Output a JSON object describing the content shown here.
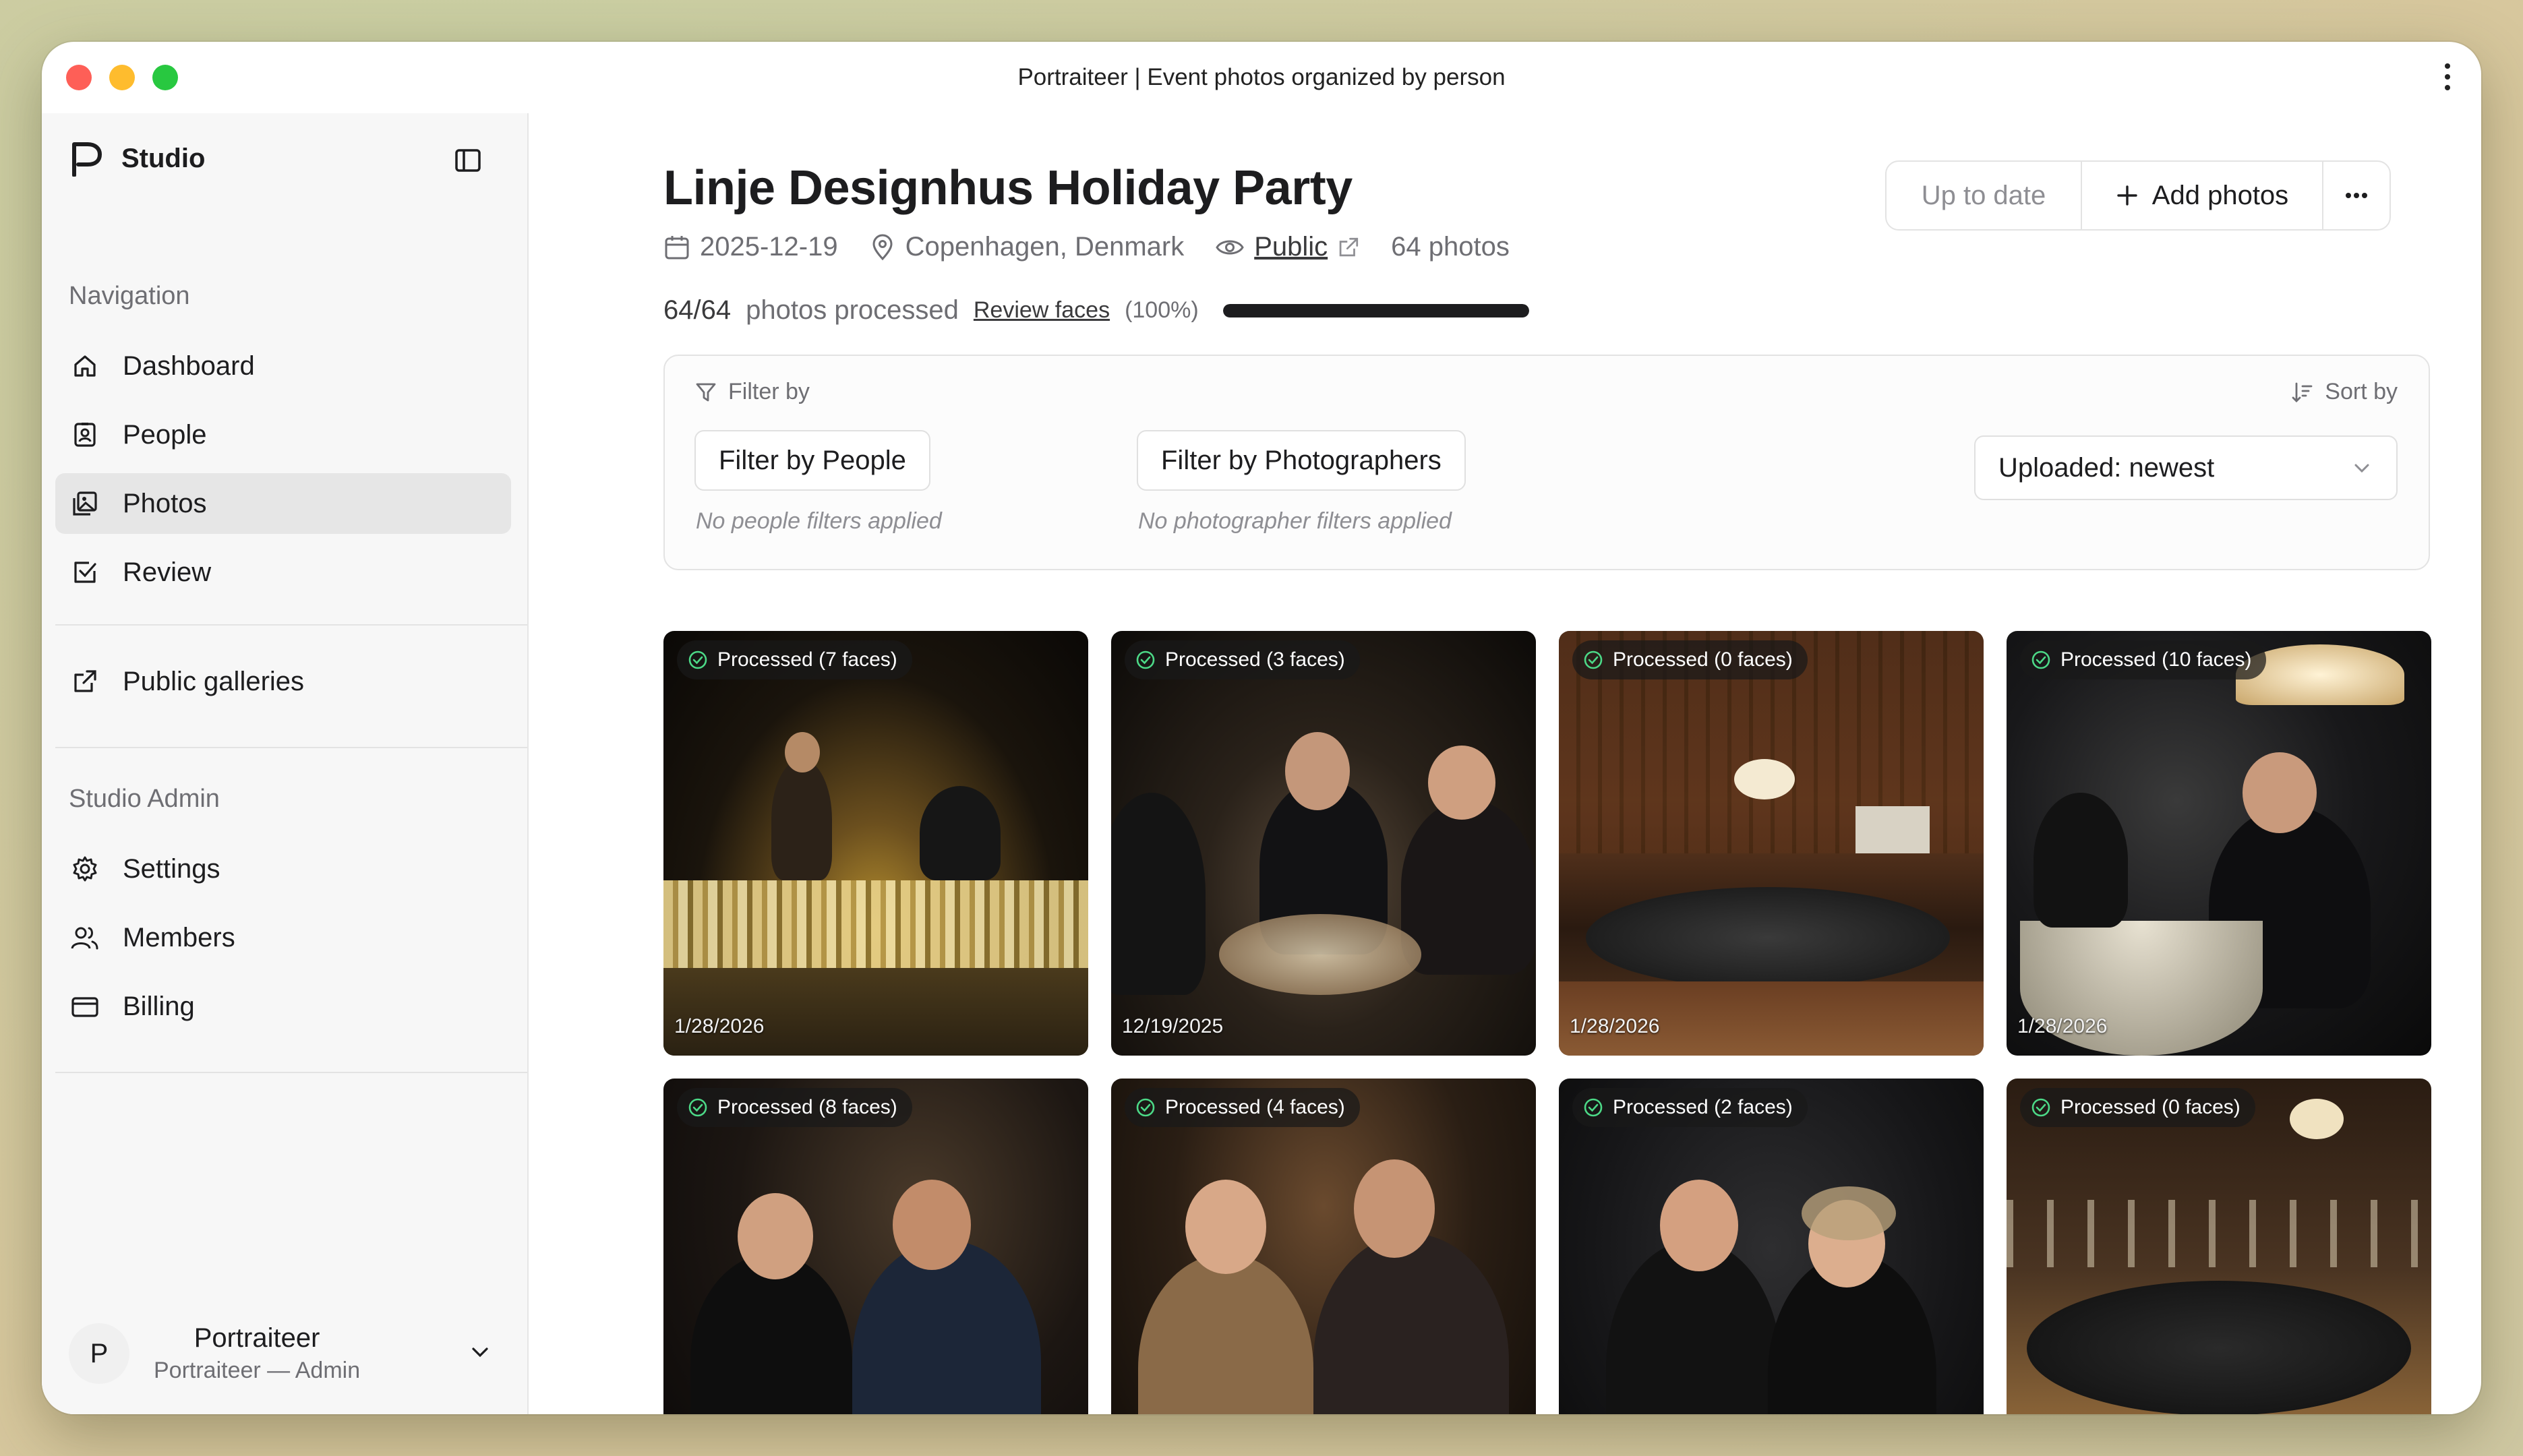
{
  "window": {
    "title": "Portraiteer | Event photos organized by person"
  },
  "sidebar": {
    "brand": "Studio",
    "nav_label": "Navigation",
    "nav": [
      {
        "label": "Dashboard",
        "icon": "home-icon"
      },
      {
        "label": "People",
        "icon": "person-badge-icon"
      },
      {
        "label": "Photos",
        "icon": "photos-icon",
        "active": true
      },
      {
        "label": "Review",
        "icon": "checkbox-icon"
      }
    ],
    "public_galleries": "Public galleries",
    "admin_label": "Studio Admin",
    "admin": [
      {
        "label": "Settings",
        "icon": "gear-icon"
      },
      {
        "label": "Members",
        "icon": "users-icon"
      },
      {
        "label": "Billing",
        "icon": "card-icon"
      }
    ],
    "user": {
      "initial": "P",
      "name": "Portraiteer",
      "role": "Portraiteer — Admin"
    }
  },
  "event": {
    "title": "Linje Designhus Holiday Party",
    "date": "2025-12-19",
    "location": "Copenhagen, Denmark",
    "visibility": "Public",
    "photo_count": "64 photos"
  },
  "progress": {
    "count": "64/64",
    "text": "photos processed",
    "review_link": "Review faces",
    "percent_label": "(100%)",
    "fraction": 1.0
  },
  "actions": {
    "status": "Up to date",
    "add": "Add photos"
  },
  "filters": {
    "filter_label": "Filter by",
    "sort_label": "Sort by",
    "people_button": "Filter by People",
    "people_note": "No people filters applied",
    "photographers_button": "Filter by Photographers",
    "photographers_note": "No photographer filters applied",
    "sort_value": "Uploaded: newest"
  },
  "photos": [
    {
      "badge": "Processed (7 faces)",
      "date": "1/28/2026"
    },
    {
      "badge": "Processed (3 faces)",
      "date": "12/19/2025"
    },
    {
      "badge": "Processed (0 faces)",
      "date": "1/28/2026"
    },
    {
      "badge": "Processed (10 faces)",
      "date": "1/28/2026"
    },
    {
      "badge": "Processed (8 faces)",
      "date": ""
    },
    {
      "badge": "Processed (4 faces)",
      "date": ""
    },
    {
      "badge": "Processed (2 faces)",
      "date": ""
    },
    {
      "badge": "Processed (0 faces)",
      "date": ""
    }
  ],
  "colors": {
    "accent": "#1d1d1f",
    "sidebar_bg": "#f7f7f7",
    "active_nav": "#e6e6e6"
  }
}
